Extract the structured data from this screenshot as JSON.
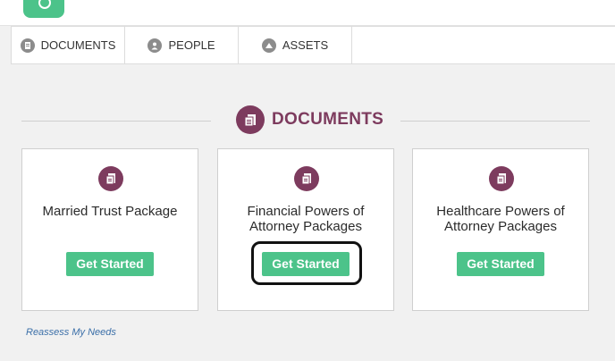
{
  "tabs": [
    {
      "label": "DOCUMENTS",
      "icon": "documents-icon"
    },
    {
      "label": "PEOPLE",
      "icon": "people-icon"
    },
    {
      "label": "ASSETS",
      "icon": "assets-icon"
    }
  ],
  "section": {
    "title": "DOCUMENTS",
    "icon": "documents-icon"
  },
  "cards": [
    {
      "title": "Married Trust Package",
      "button": "Get Started"
    },
    {
      "title": "Financial Powers of Attorney Packages",
      "button": "Get Started"
    },
    {
      "title": "Healthcare Powers of Attorney Packages",
      "button": "Get Started"
    }
  ],
  "footer": {
    "link": "Reassess My Needs"
  },
  "colors": {
    "accent": "#4cc38a",
    "brand": "#7d3b5e",
    "link": "#3b6fa8"
  }
}
